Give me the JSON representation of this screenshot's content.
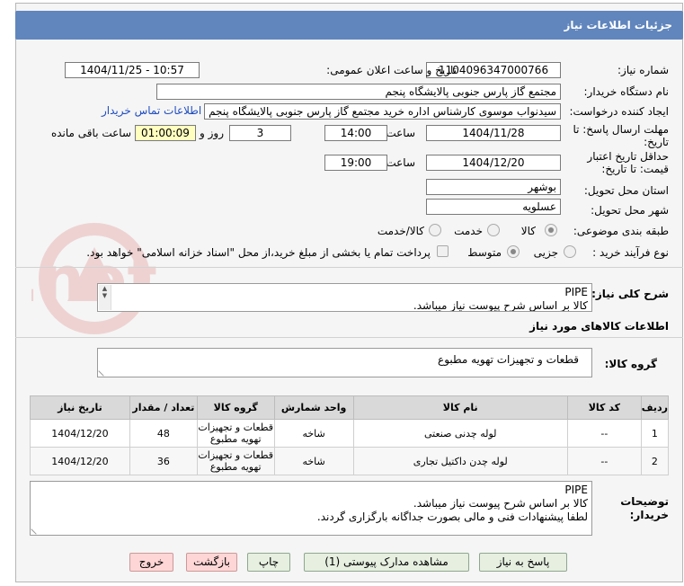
{
  "header": {
    "title": "جزئیات اطلاعات نیاز"
  },
  "watermark": {
    "text": "AriaTender.net"
  },
  "fields": {
    "need_number_label": "شماره نیاز:",
    "need_number": "1104096347000766",
    "announce_label": "تاریخ و ساعت اعلان عمومی:",
    "announce_value": "1404/11/25 - 10:57",
    "buyer_label": "نام دستگاه خریدار:",
    "buyer_value": "مجتمع گاز پارس جنوبی  پالایشگاه پنجم",
    "creator_label": "ایجاد کننده درخواست:",
    "creator_value": "سیدنواب موسوی کارشناس اداره خرید مجتمع گاز پارس جنوبی  پالایشگاه پنجم",
    "contact_link": "اطلاعات تماس خریدار",
    "deadline_label_1": "مهلت ارسال پاسخ: تا",
    "deadline_label_2": "تاریخ:",
    "deadline_date": "1404/11/28",
    "time_label": "ساعت",
    "deadline_time": "14:00",
    "days": "3",
    "days_label": "روز و",
    "remaining": "01:00:09",
    "remaining_label": "ساعت باقی مانده",
    "validity_label_1": "حداقل تاریخ اعتبار",
    "validity_label_2": "قیمت: تا تاریخ:",
    "validity_date": "1404/12/20",
    "validity_time": "19:00",
    "province_label": "استان محل تحویل:",
    "province_value": "بوشهر",
    "city_label": "شهر محل تحویل:",
    "city_value": "عسلویه",
    "category_label": "طبقه بندی موضوعی:",
    "category_options": [
      "کالا",
      "خدمت",
      "کالا/خدمت"
    ],
    "process_label": "نوع فرآیند خرید :",
    "process_options": [
      "جزیی",
      "متوسط"
    ],
    "payment_note": "پرداخت تمام یا بخشی از مبلغ خرید،از محل \"اسناد خزانه اسلامی\" خواهد بود."
  },
  "description": {
    "label": "شرح کلی نیاز:",
    "line1": "PIPE",
    "line2": "کالا بر اساس شرح پیوست نیاز میباشد."
  },
  "goods_section": {
    "title": "اطلاعات کالاهای مورد نیاز",
    "group_label": "گروه کالا:",
    "group_value": "قطعات و تجهیزات تهویه مطبوع"
  },
  "table": {
    "headers": [
      "ردیف",
      "کد کالا",
      "نام کالا",
      "واحد شمارش",
      "گروه کالا",
      "تعداد / مقدار",
      "تاریخ نیاز"
    ],
    "rows": [
      {
        "row": "1",
        "code": "--",
        "name": "لوله چدنی صنعتی",
        "unit": "شاخه",
        "group": "قطعات و تجهیزات تهویه مطبوع",
        "qty": "48",
        "date": "1404/12/20"
      },
      {
        "row": "2",
        "code": "--",
        "name": "لوله چدن داکتیل تجاری",
        "unit": "شاخه",
        "group": "قطعات و تجهیزات تهویه مطبوع",
        "qty": "36",
        "date": "1404/12/20"
      }
    ]
  },
  "buyer_notes": {
    "label_1": "توضیحات",
    "label_2": "خریدار:",
    "line1": "PIPE",
    "line2": "کالا بر اساس شرح پیوست نیاز میباشد.",
    "line3": "لطفا پیشنهادات فنی و مالی بصورت جداگانه بارگزاری گردند."
  },
  "buttons": {
    "reply": "پاسخ به نیاز",
    "attachments": "مشاهده مدارک پیوستی (1)",
    "print": "چاپ",
    "back": "بازگشت",
    "exit": "خروج"
  },
  "colors": {
    "header": "#6186bd",
    "link": "#1f4cc2",
    "remaining_bg": "#ffffc0"
  }
}
